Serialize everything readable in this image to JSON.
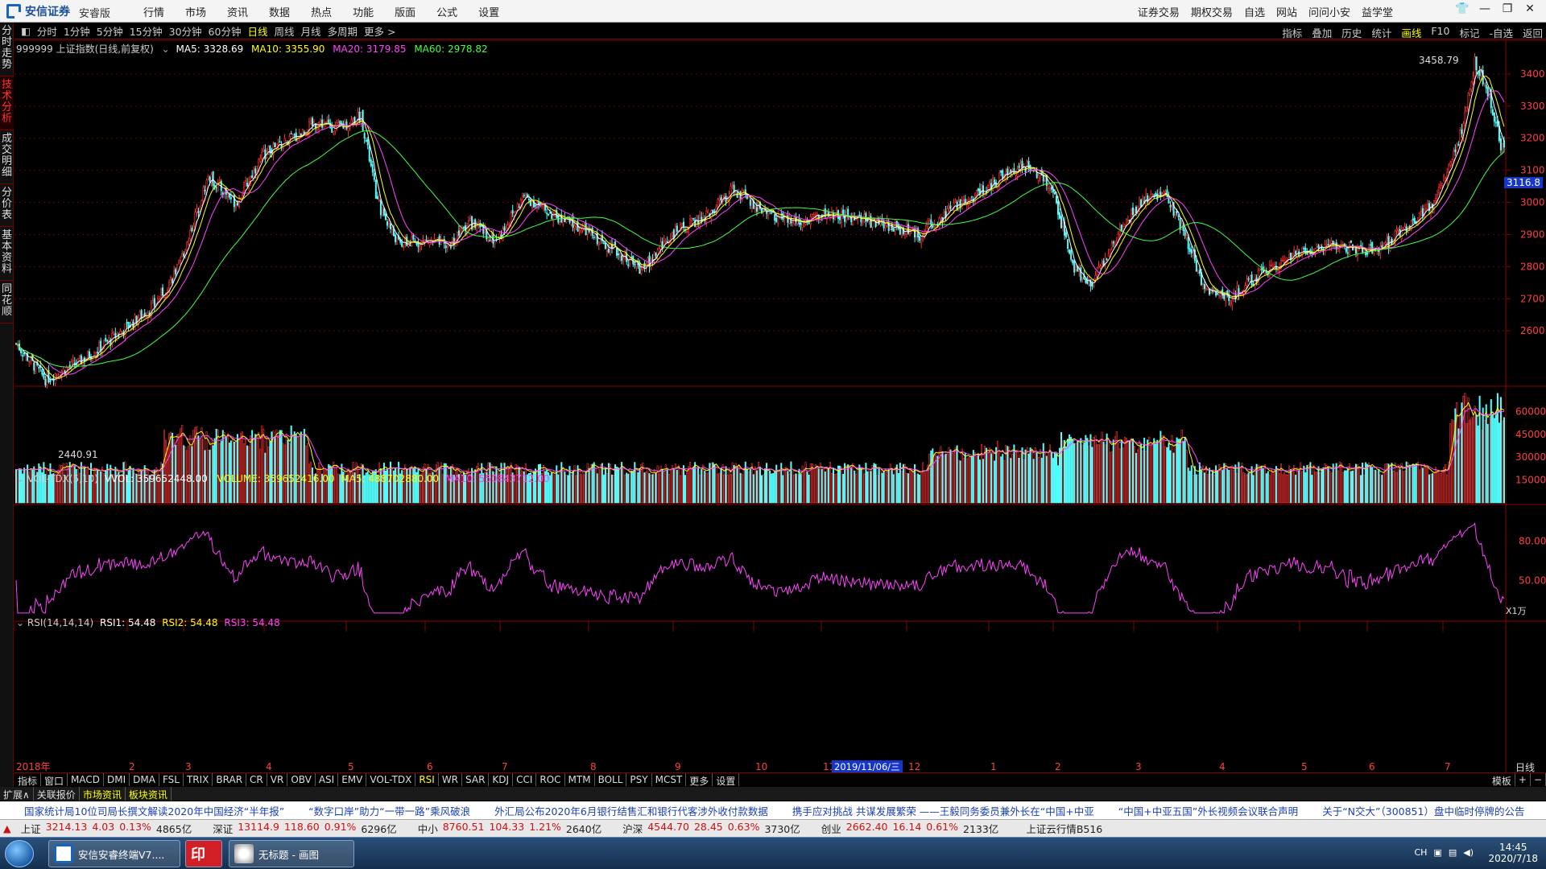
{
  "titlebar": {
    "brand": "安信证券",
    "edition": "安睿版",
    "menu": [
      "行情",
      "市场",
      "资讯",
      "数据",
      "热点",
      "功能",
      "版面",
      "公式",
      "设置"
    ],
    "right_menu": [
      "证券交易",
      "期权交易",
      "自选",
      "网站",
      "问问小安",
      "益学堂"
    ],
    "window_controls": [
      "minimize-icon",
      "restore-icon",
      "close-icon"
    ]
  },
  "left_tabs": [
    {
      "label": "分时走势",
      "active": false
    },
    {
      "label": "技术分析",
      "active": true
    },
    {
      "label": "成交明细",
      "active": false
    },
    {
      "label": "分价表",
      "active": false
    },
    {
      "label": "基本资料",
      "active": false
    },
    {
      "label": "同花顺",
      "active": false
    }
  ],
  "toolbar": {
    "periods": [
      "分时",
      "1分钟",
      "5分钟",
      "15分钟",
      "30分钟",
      "60分钟",
      "日线",
      "周线",
      "月线",
      "多周期",
      "更多 >"
    ],
    "active_period": "日线",
    "right": [
      "指标",
      "叠加",
      "历史",
      "统计",
      "画线",
      "F10",
      "标记",
      "-自选",
      "返回"
    ]
  },
  "main_chart": {
    "title": "999999 上证指数(日线,前复权)",
    "ma_labels": [
      {
        "text": "MA5: 3328.69",
        "color": "#ffffff"
      },
      {
        "text": "MA10: 3355.90",
        "color": "#ffff00"
      },
      {
        "text": "MA20: 3179.85",
        "color": "#ff44ff"
      },
      {
        "text": "MA60: 2978.82",
        "color": "#44ff44"
      }
    ],
    "high_label": "3458.79",
    "low_label": "2440.91",
    "current_price": "3116.8",
    "y_ticks": [
      "3400",
      "3300",
      "3200",
      "3100",
      "3000",
      "2900",
      "2800",
      "2700",
      "2600"
    ]
  },
  "volume_chart": {
    "title": "VOL-TDX(5,10)",
    "labels": [
      {
        "text": "VVOL: 359652448.00",
        "color": "#ffffff"
      },
      {
        "text": "VOLUME: 359652416.00",
        "color": "#ffff00"
      },
      {
        "text": "MA5: 488702880.00",
        "color": "#ffff00"
      },
      {
        "text": "MA10: 550843712.00",
        "color": "#ff44ff"
      }
    ],
    "y_ticks": [
      "60000",
      "45000",
      "30000",
      "15000"
    ],
    "unit": "X1万"
  },
  "rsi_chart": {
    "title": "RSI(14,14,14)",
    "labels": [
      {
        "text": "RSI1: 54.48",
        "color": "#ffffff"
      },
      {
        "text": "RSI2: 54.48",
        "color": "#ffff00"
      },
      {
        "text": "RSI3: 54.48",
        "color": "#ff44ff"
      }
    ],
    "y_ticks": [
      "80.00",
      "50.00"
    ]
  },
  "x_axis": {
    "labels": [
      "2018年",
      "2",
      "3",
      "4",
      "5",
      "6",
      "7",
      "8",
      "9",
      "10",
      "11",
      "12",
      "1",
      "2",
      "3",
      "4",
      "5",
      "6",
      "7"
    ],
    "cursor_date": "2019/11/06/三",
    "period": "日线"
  },
  "indicator_tabs": [
    "指标",
    "窗口",
    "MACD",
    "DMI",
    "DMA",
    "FSL",
    "TRIX",
    "BRAR",
    "CR",
    "VR",
    "OBV",
    "ASI",
    "EMV",
    "VOL-TDX",
    "RSI",
    "WR",
    "SAR",
    "KDJ",
    "CCI",
    "ROC",
    "MTM",
    "BOLL",
    "PSY",
    "MCST",
    "更多",
    "设置"
  ],
  "active_indicator": "RSI",
  "template_label": "模板",
  "sub_tabs": [
    "扩展∧",
    "关联报价",
    "市场资讯",
    "板块资讯"
  ],
  "active_sub_tab": "市场资讯",
  "news": [
    "国家统计局10位司局长撰文解读2020年中国经济“半年报”",
    "“数字口岸”助力“一带一路”乘风破浪",
    "外汇局公布2020年6月银行结售汇和银行代客涉外收付款数据",
    "携手应对挑战 共谋发展繁荣 ——王毅同务委员兼外长在“中国+中亚",
    "“中国+中亚五国”外长视频会议联合声明",
    "关于“N交大”（300851）盘中临时停牌的公告"
  ],
  "quotes": [
    {
      "name": "上证",
      "price": "3214.13",
      "chg": "4.03",
      "pct": "0.13%",
      "amt": "4865亿"
    },
    {
      "name": "深证",
      "price": "13114.9",
      "chg": "118.60",
      "pct": "0.91%",
      "amt": "6296亿"
    },
    {
      "name": "中小",
      "price": "8760.51",
      "chg": "104.33",
      "pct": "1.21%",
      "amt": "2640亿"
    },
    {
      "name": "沪深",
      "price": "4544.70",
      "chg": "28.45",
      "pct": "0.63%",
      "amt": "3730亿"
    },
    {
      "name": "创业",
      "price": "2662.40",
      "chg": "16.14",
      "pct": "0.61%",
      "amt": "2133亿"
    }
  ],
  "cloud_label": "上证云行情B516",
  "taskbar": {
    "tasks": [
      "安信安睿终端V7....",
      "无标题 - 画图"
    ],
    "time": "14:45",
    "date": "2020/7/18",
    "lang": "CH"
  }
}
